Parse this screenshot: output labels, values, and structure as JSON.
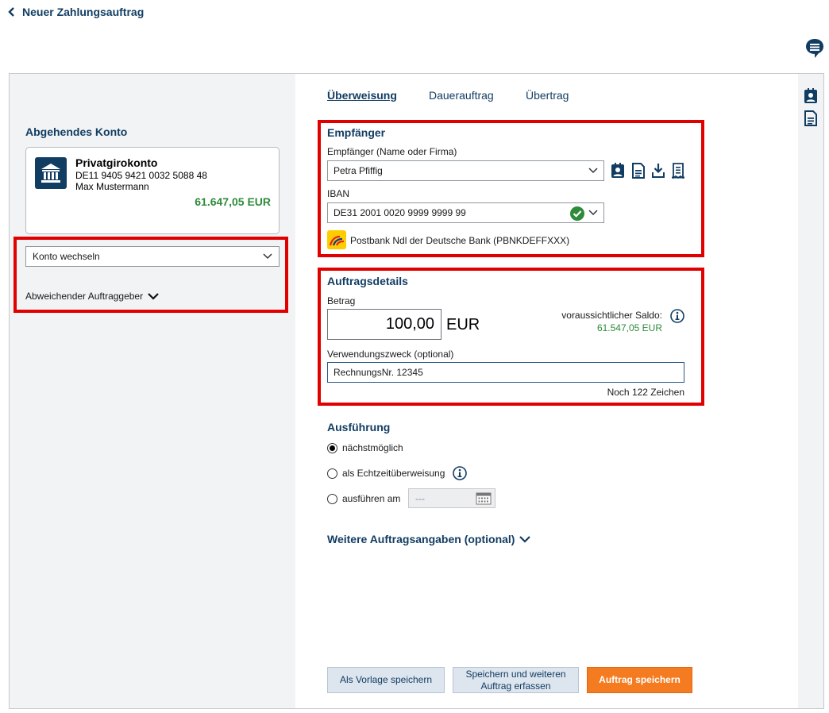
{
  "header": {
    "title": "Neuer Zahlungsauftrag",
    "chat_icon": "chat-bubble-icon"
  },
  "left": {
    "section_title": "Abgehendes Konto",
    "account": {
      "name": "Privatgirokonto",
      "iban": "DE11 9405 9421 0032 5088 48",
      "owner": "Max Mustermann",
      "balance": "61.647,05 EUR",
      "icon": "bank-building-icon"
    },
    "switch_account_label": "Konto wechseln",
    "alt_payer_label": "Abweichender Auftraggeber"
  },
  "tabs": [
    {
      "label": "Überweisung",
      "active": true
    },
    {
      "label": "Dauerauftrag",
      "active": false
    },
    {
      "label": "Übertrag",
      "active": false
    }
  ],
  "recipient": {
    "section_title": "Empfänger",
    "name_label": "Empfänger (Name oder Firma)",
    "name_value": "Petra Pfiffig",
    "iban_label": "IBAN",
    "iban_value": "DE31 2001 0020 9999 9999 99",
    "bank_name": "Postbank Ndl der Deutsche Bank",
    "bic": "(PBNKDEFFXXX)",
    "tool_icons": [
      "address-book-icon",
      "document-icon",
      "download-icon",
      "receipt-icon"
    ]
  },
  "details": {
    "section_title": "Auftragsdetails",
    "amount_label": "Betrag",
    "amount_value": "100,00",
    "currency": "EUR",
    "saldo_label": "voraussichtlicher Saldo:",
    "saldo_value": "61.547,05 EUR",
    "purpose_label": "Verwendungszweck (optional)",
    "purpose_value": "RechnungsNr. 12345",
    "chars_left": "Noch 122 Zeichen"
  },
  "execution": {
    "section_title": "Ausführung",
    "options": [
      {
        "label": "nächstmöglich",
        "selected": true
      },
      {
        "label": "als Echtzeitüberweisung",
        "selected": false
      },
      {
        "label": "ausführen am",
        "selected": false
      }
    ],
    "date_placeholder": "---"
  },
  "more_details_label": "Weitere Auftragsangaben (optional)",
  "buttons": {
    "save_template": "Als Vorlage speichern",
    "save_and_new_line1": "Speichern und weiteren",
    "save_and_new_line2": "Auftrag erfassen",
    "save_order": "Auftrag speichern"
  },
  "colors": {
    "navy": "#123d63",
    "positive_green": "#2e8b3a",
    "primary_orange": "#f47b20",
    "highlight_red": "#e10000"
  }
}
